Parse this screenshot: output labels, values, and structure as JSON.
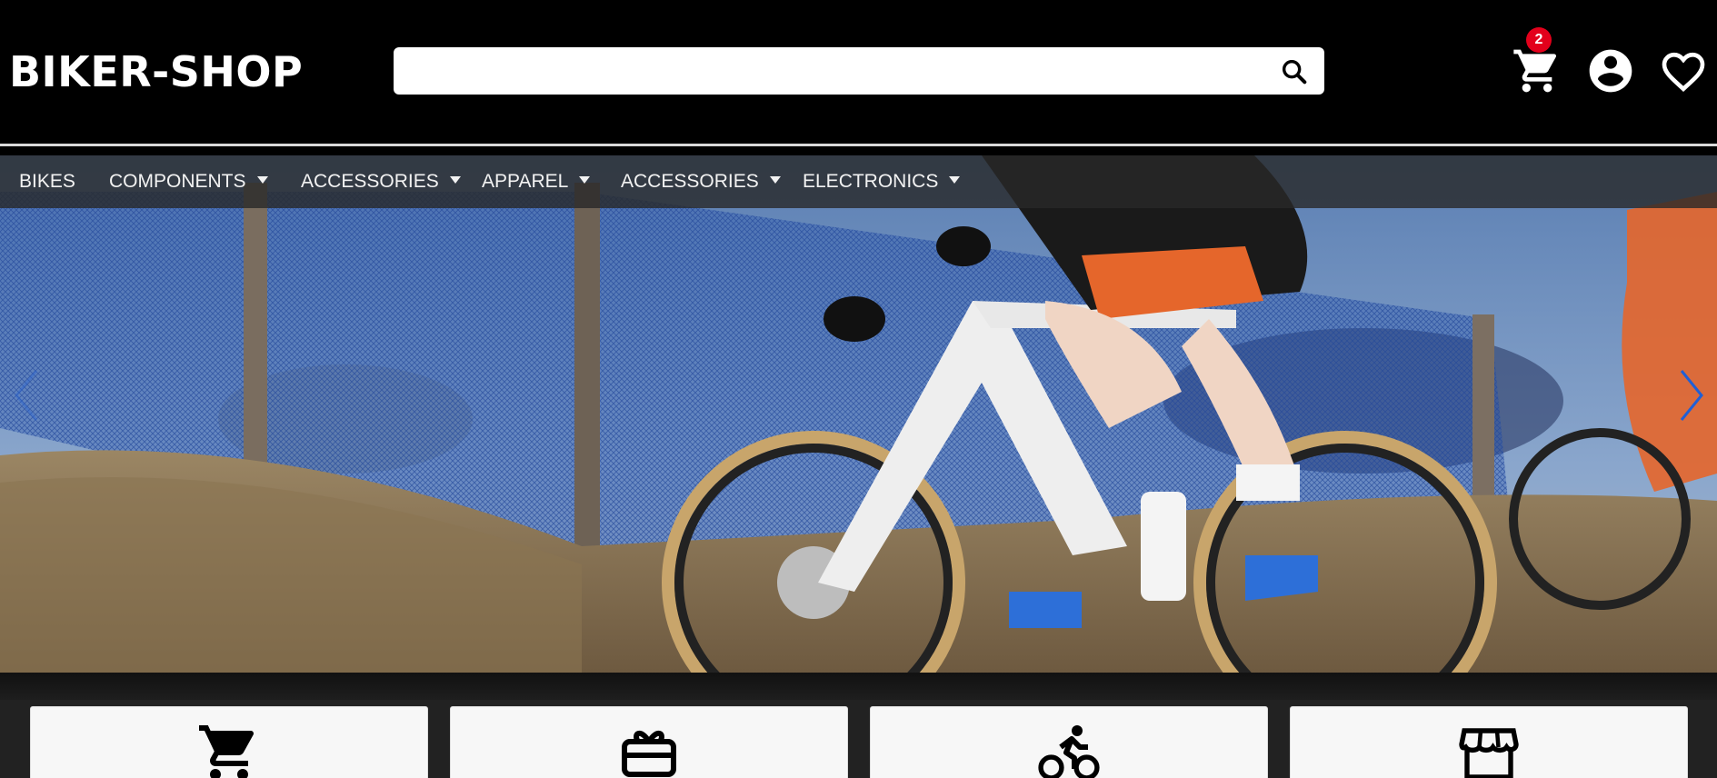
{
  "header": {
    "logo_text": "BIKER-SHOP",
    "search": {
      "value": "",
      "placeholder": ""
    },
    "cart_count": "2",
    "icons": [
      "search-icon",
      "cart-icon",
      "account-icon",
      "heart-icon"
    ]
  },
  "nav": {
    "items": [
      {
        "label": "BIKES",
        "has_dropdown": false
      },
      {
        "label": "COMPONENTS",
        "has_dropdown": true
      },
      {
        "label": "ACCESSORIES",
        "has_dropdown": true
      },
      {
        "label": "APPAREL",
        "has_dropdown": true
      },
      {
        "label": "ACCESSORIES",
        "has_dropdown": true
      },
      {
        "label": "ELECTRONICS",
        "has_dropdown": true
      }
    ]
  },
  "hero": {
    "slide_image": "cyclocross-race-photo",
    "prev_icon": "chevron-left-icon",
    "next_icon": "chevron-right-icon"
  },
  "feature_cards": [
    {
      "icon": "cart-icon"
    },
    {
      "icon": "gift-card-icon"
    },
    {
      "icon": "cyclist-icon"
    },
    {
      "icon": "store-icon"
    }
  ],
  "colors": {
    "header_bg": "#000000",
    "badge": "#e3001b",
    "nav_bg": "rgba(40,40,40,0.8)",
    "arrow": "#1f5fd6"
  }
}
